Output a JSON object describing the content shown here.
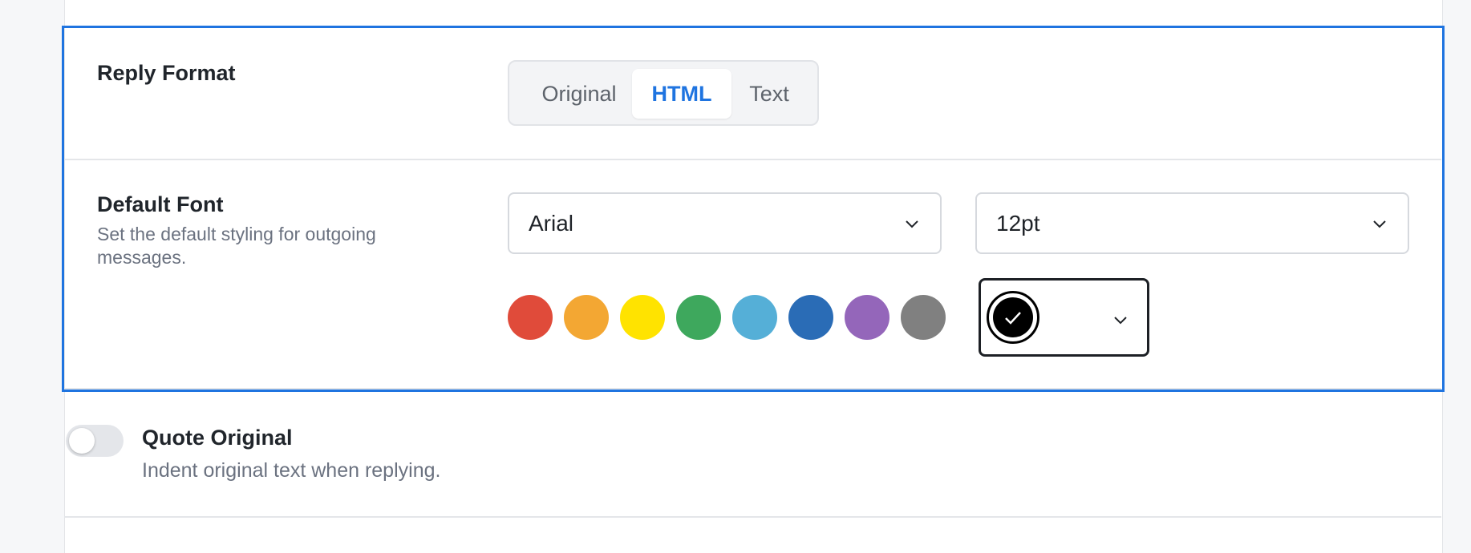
{
  "reply_format": {
    "title": "Reply Format",
    "options": [
      "Original",
      "HTML",
      "Text"
    ],
    "selected": "HTML"
  },
  "default_font": {
    "title": "Default Font",
    "description": "Set the default styling for outgoing messages.",
    "font_family": "Arial",
    "font_size": "12pt",
    "swatches": [
      {
        "name": "red",
        "color": "#e04b3a"
      },
      {
        "name": "orange",
        "color": "#f3a733"
      },
      {
        "name": "yellow",
        "color": "#ffe300"
      },
      {
        "name": "green",
        "color": "#3ea85d"
      },
      {
        "name": "light-blue",
        "color": "#55afd7"
      },
      {
        "name": "blue",
        "color": "#2a6cb6"
      },
      {
        "name": "purple",
        "color": "#9466ba"
      },
      {
        "name": "gray",
        "color": "#808080"
      }
    ],
    "selected_color": "#000000"
  },
  "quote_original": {
    "title": "Quote Original",
    "description": "Indent original text when replying.",
    "enabled": false
  },
  "colors": {
    "accent": "#1f74e0"
  },
  "icons": {
    "dropdown": "chevron-down-icon",
    "selected": "checkmark-icon"
  }
}
